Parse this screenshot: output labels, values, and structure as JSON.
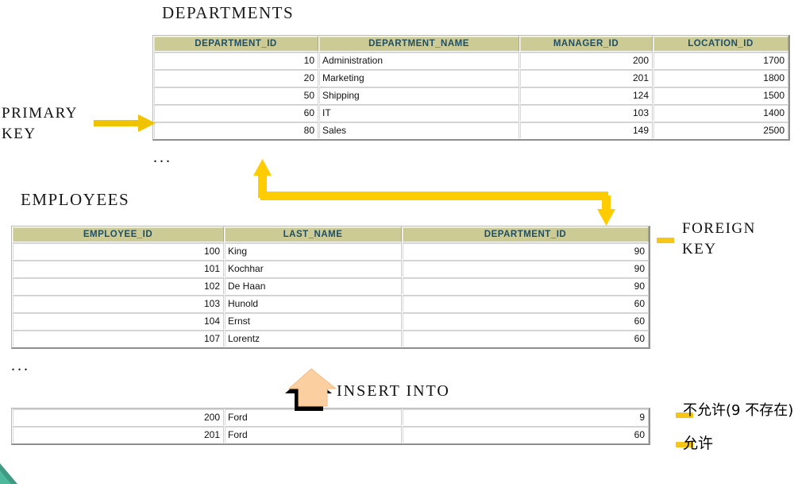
{
  "departments": {
    "title": "DEPARTMENTS",
    "columns": [
      "DEPARTMENT_ID",
      "DEPARTMENT_NAME",
      "MANAGER_ID",
      "LOCATION_ID"
    ],
    "rows": [
      [
        "10",
        "Administration",
        "200",
        "1700"
      ],
      [
        "20",
        "Marketing",
        "201",
        "1800"
      ],
      [
        "50",
        "Shipping",
        "124",
        "1500"
      ],
      [
        "60",
        "IT",
        "103",
        "1400"
      ],
      [
        "80",
        "Sales",
        "149",
        "2500"
      ]
    ],
    "ellipsis": "..."
  },
  "employees": {
    "title": "EMPLOYEES",
    "columns": [
      "EMPLOYEE_ID",
      "LAST_NAME",
      "DEPARTMENT_ID"
    ],
    "rows": [
      [
        "100",
        "King",
        "90"
      ],
      [
        "101",
        "Kochhar",
        "90"
      ],
      [
        "102",
        "De Haan",
        "90"
      ],
      [
        "103",
        "Hunold",
        "60"
      ],
      [
        "104",
        "Ernst",
        "60"
      ],
      [
        "107",
        "Lorentz",
        "60"
      ]
    ],
    "ellipsis": "..."
  },
  "inserted_rows": [
    [
      "200",
      "Ford",
      "9"
    ],
    [
      "201",
      "Ford",
      "60"
    ]
  ],
  "labels": {
    "primary_key": "PRIMARY\nKEY",
    "foreign_key": "FOREIGN\nKEY",
    "insert_into": "INSERT  INTO",
    "not_allowed": "不允许(9 不存在)",
    "allowed": "允许"
  },
  "icons": {
    "primary_key_arrow": "arrow-right-icon",
    "relation_arrow": "elbow-double-arrow-icon",
    "insert_arrow": "arrow-up-block-icon",
    "legend_dash": "dash-marker-icon"
  },
  "colors": {
    "header_bg": "#cdcb95",
    "header_text": "#1f4e63",
    "arrow_gold": "#ffcc00",
    "legend_dash": "#f5c518",
    "insert_arrow_fill": "#fbcfa0",
    "insert_arrow_shadow": "#000000",
    "corner_accent": "#1f8a70"
  }
}
